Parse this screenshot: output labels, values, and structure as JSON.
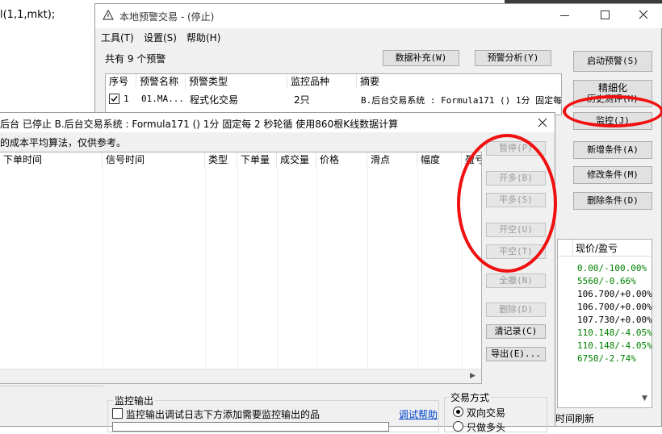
{
  "code_snippet": "l(1,1,mkt);",
  "main_window": {
    "title": "本地预警交易 - (停止)",
    "menu": [
      "工具(T)",
      "设置(S)",
      "帮助(H)"
    ],
    "count_label": "共有 9 个预警",
    "buttons": {
      "data_fill": "数据补充(W)",
      "analysis": "预警分析(Y)"
    },
    "table": {
      "headers": [
        "序号",
        "预警名称",
        "预警类型",
        "监控品种",
        "摘要"
      ],
      "row": {
        "index": "1",
        "name": "01.MA...",
        "type": "程式化交易",
        "symbols": "2只",
        "summary": "B.后台交易系统 : Formula171 () 1分 固定每"
      }
    },
    "side_buttons": {
      "start": "启动预警(S)",
      "refine_line1": "精细化",
      "refine_line2": "历史测评(H)",
      "monitor": "监控(J)",
      "add_cond": "新增条件(A)",
      "edit_cond": "修改条件(M)",
      "delete_cond": "删除条件(D)"
    },
    "price_panel": {
      "header": "现价/盈亏",
      "values": [
        {
          "text": "0.00/-100.00%",
          "color": "#008000"
        },
        {
          "text": "5560/-0.66%",
          "color": "#008000"
        },
        {
          "text": "106.700/+0.00%",
          "color": "#000000"
        },
        {
          "text": "106.700/+0.00%",
          "color": "#000000"
        },
        {
          "text": "107.730/+0.00%",
          "color": "#000000"
        },
        {
          "text": "110.148/-4.05%",
          "color": "#008000"
        },
        {
          "text": "110.148/-4.05%",
          "color": "#008000"
        },
        {
          "text": "6750/-2.74%",
          "color": "#008000"
        }
      ]
    },
    "bottom_text": "时间刷新"
  },
  "monitor_dialog": {
    "title": "后台 已停止  B.后台交易系统 : Formula171 () 1分 固定每 2 秒轮循 使用860根K线数据计算",
    "note": "的成本平均算法，仅供参考。",
    "headers": [
      "下单时间",
      "信号时间",
      "类型",
      "下单量",
      "成交量",
      "价格",
      "滑点",
      "幅度",
      "盈亏"
    ],
    "buttons": {
      "pause": "暂停(P)",
      "open_long": "开多(B)",
      "close_long": "平多(S)",
      "open_short": "开空(U)",
      "close_short": "平空(T)",
      "cancel_all": "全撤(N)",
      "delete": "删除(D)",
      "clear_log": "清记录(C)",
      "export": "导出(E)..."
    },
    "output_group": {
      "label": "监控输出",
      "checkbox": "监控输出调试日志下方添加需要监控输出的品",
      "help_link": "调试帮助"
    },
    "trade_mode": {
      "label": "交易方式",
      "bidirectional": "双向交易",
      "long_only": "只做多头"
    }
  }
}
